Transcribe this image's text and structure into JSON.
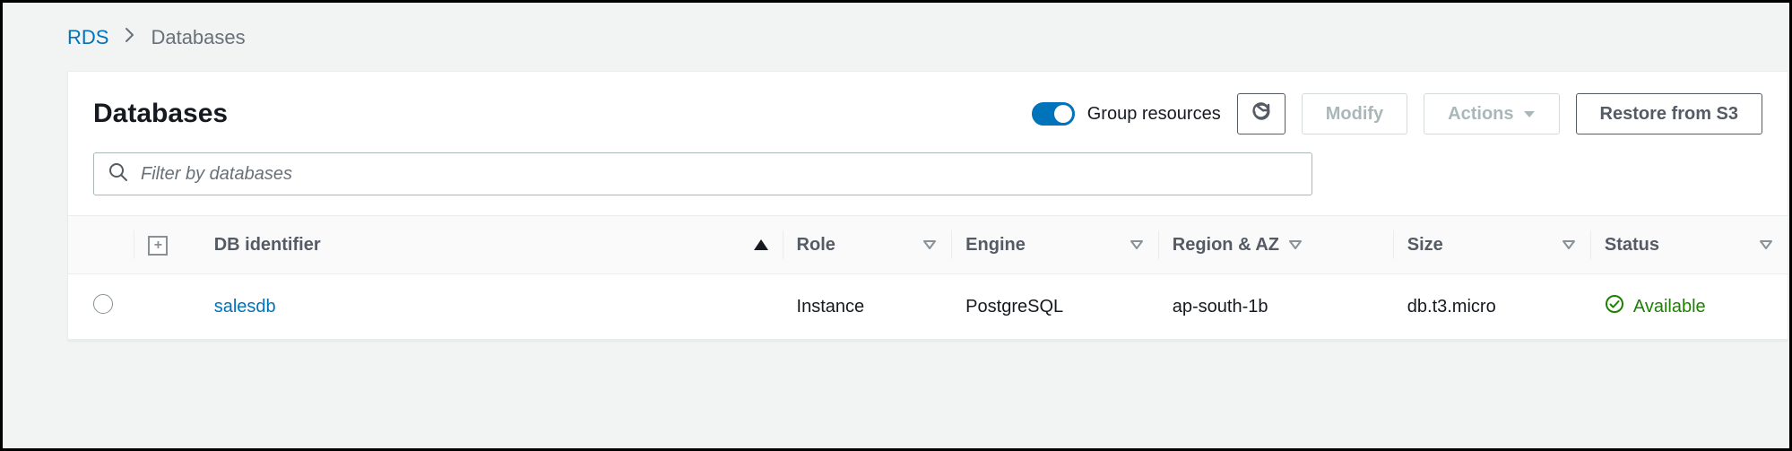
{
  "breadcrumb": {
    "root": "RDS",
    "current": "Databases"
  },
  "header": {
    "title": "Databases",
    "group_toggle_label": "Group resources",
    "modify_label": "Modify",
    "actions_label": "Actions",
    "restore_label": "Restore from S3"
  },
  "search": {
    "placeholder": "Filter by databases"
  },
  "columns": {
    "db_identifier": "DB identifier",
    "role": "Role",
    "engine": "Engine",
    "region_az": "Region & AZ",
    "size": "Size",
    "status": "Status"
  },
  "rows": [
    {
      "identifier": "salesdb",
      "role": "Instance",
      "engine": "PostgreSQL",
      "region_az": "ap-south-1b",
      "size": "db.t3.micro",
      "status": "Available"
    }
  ],
  "colors": {
    "link": "#0073bb",
    "status_ok": "#1d8102"
  }
}
